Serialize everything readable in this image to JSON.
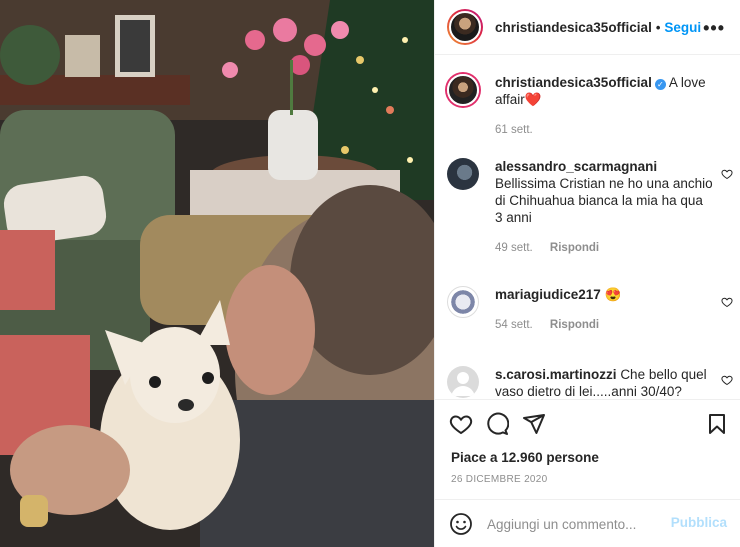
{
  "header": {
    "username": "christiandesica35official",
    "separator": "•",
    "follow_label": "Segui",
    "more_icon": "more-horizontal-icon"
  },
  "caption": {
    "username": "christiandesica35official",
    "verified": true,
    "text": "A love affair❤️",
    "time": "61 sett."
  },
  "comments": [
    {
      "username": "alessandro_scarmagnani",
      "text": "Bellissima Cristian ne ho una anchio di Chihuahua bianca la mia ha qua 3 anni",
      "time": "49 sett.",
      "reply_label": "Rispondi"
    },
    {
      "username": "mariagiudice217",
      "text": "😍",
      "time": "54 sett.",
      "reply_label": "Rispondi"
    },
    {
      "username": "s.carosi.martinozzi",
      "text": "Che bello quel vaso dietro di lei.....anni 30/40?",
      "time": "",
      "reply_label": ""
    }
  ],
  "actions": {
    "icons": [
      "heart-icon",
      "comment-icon",
      "share-icon",
      "bookmark-icon"
    ],
    "likes_text": "Piace a 12.960 persone",
    "date": "26 DICEMBRE 2020"
  },
  "add_comment": {
    "placeholder": "Aggiungi un commento...",
    "publish_label": "Pubblica"
  },
  "colors": {
    "accent": "#0095f6",
    "publish_disabled": "#b2dffc",
    "verified": "#3897f0",
    "secondary_text": "#8e8e8e"
  }
}
